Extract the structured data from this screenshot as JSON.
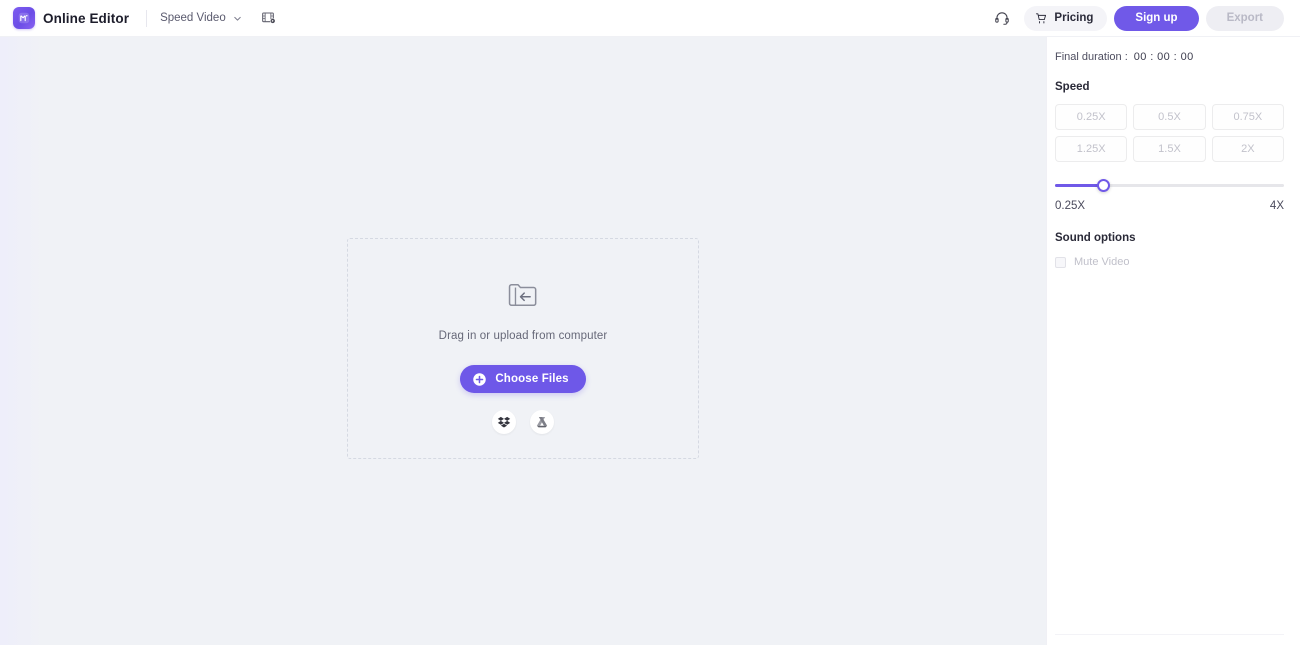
{
  "header": {
    "brand": "Online Editor",
    "logo_icon": "logo-m-icon",
    "document_title": "Speed Video",
    "chevron_icon": "chevron-down-icon",
    "film_icon": "video-clip-icon",
    "support_icon": "headset-icon",
    "cart_icon": "shopping-cart-icon",
    "pricing_label": "Pricing",
    "signup_label": "Sign up",
    "export_label": "Export"
  },
  "canvas": {
    "dropzone": {
      "folder_icon": "folder-import-icon",
      "instruction": "Drag in or upload from computer",
      "choose_files_label": "Choose Files",
      "plus_icon": "plus-circle-icon",
      "cloud_sources": [
        {
          "name": "dropbox-icon"
        },
        {
          "name": "google-drive-icon"
        }
      ]
    }
  },
  "panel": {
    "duration_label": "Final duration :",
    "duration_value": "00 : 00 : 00",
    "speed_title": "Speed",
    "speed_presets": [
      {
        "label": "0.25X"
      },
      {
        "label": "0.5X"
      },
      {
        "label": "0.75X"
      },
      {
        "label": "1.25X"
      },
      {
        "label": "1.5X"
      },
      {
        "label": "2X"
      }
    ],
    "slider": {
      "min_label": "0.25X",
      "max_label": "4X",
      "position_percent": 21
    },
    "sound_title": "Sound options",
    "mute_label": "Mute Video",
    "mute_checked": false
  },
  "colors": {
    "accent": "#7059e8",
    "accent_button": "#6e58e8",
    "canvas_bg": "#f0f2f6",
    "panel_bg": "#ffffff",
    "disabled_text": "#c2c2cb"
  }
}
